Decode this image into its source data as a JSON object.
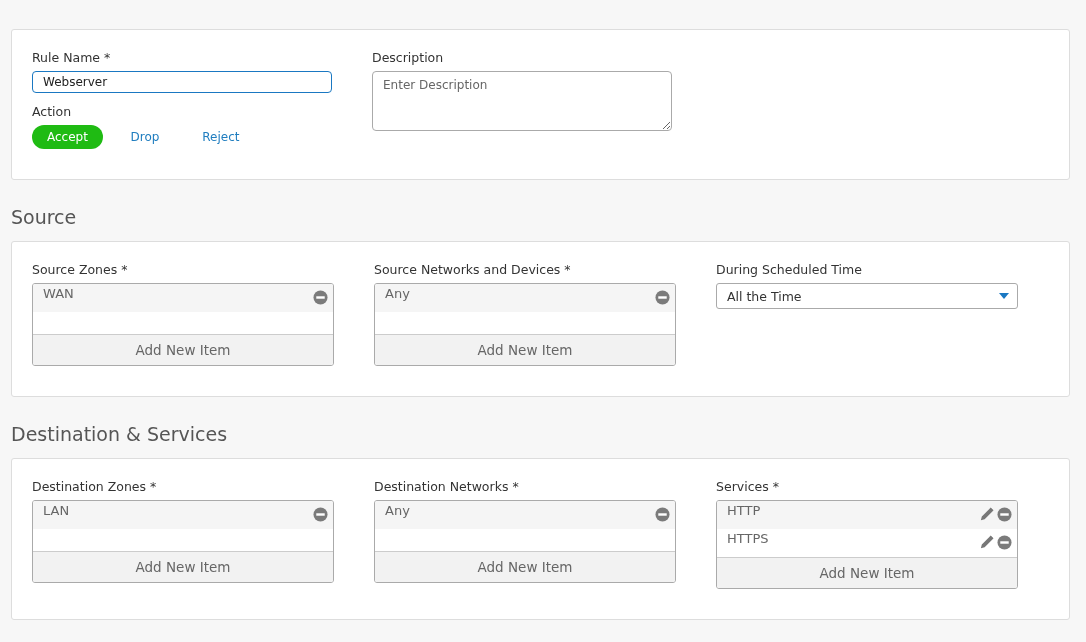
{
  "rule": {
    "name_label": "Rule Name *",
    "name_value": "Webserver",
    "action_label": "Action",
    "actions": [
      {
        "label": "Accept",
        "selected": true
      },
      {
        "label": "Drop",
        "selected": false
      },
      {
        "label": "Reject",
        "selected": false
      }
    ],
    "description_label": "Description",
    "description_placeholder": "Enter Description"
  },
  "sections": [
    {
      "heading": "Source",
      "fields": [
        {
          "kind": "list",
          "label": "Source Zones *",
          "items": [
            {
              "text": "WAN",
              "editable": false
            }
          ],
          "add_label": "Add New Item"
        },
        {
          "kind": "list",
          "label": "Source Networks and Devices *",
          "items": [
            {
              "text": "Any",
              "editable": false
            }
          ],
          "add_label": "Add New Item"
        },
        {
          "kind": "select",
          "label": "During Scheduled Time",
          "value": "All the Time"
        }
      ]
    },
    {
      "heading": "Destination & Services",
      "fields": [
        {
          "kind": "list",
          "label": "Destination Zones *",
          "items": [
            {
              "text": "LAN",
              "editable": false
            }
          ],
          "add_label": "Add New Item"
        },
        {
          "kind": "list",
          "label": "Destination Networks *",
          "items": [
            {
              "text": "Any",
              "editable": false
            }
          ],
          "add_label": "Add New Item"
        },
        {
          "kind": "list",
          "label": "Services *",
          "items": [
            {
              "text": "HTTP",
              "editable": true
            },
            {
              "text": "HTTPS",
              "editable": true
            }
          ],
          "add_label": "Add New Item"
        }
      ]
    }
  ]
}
